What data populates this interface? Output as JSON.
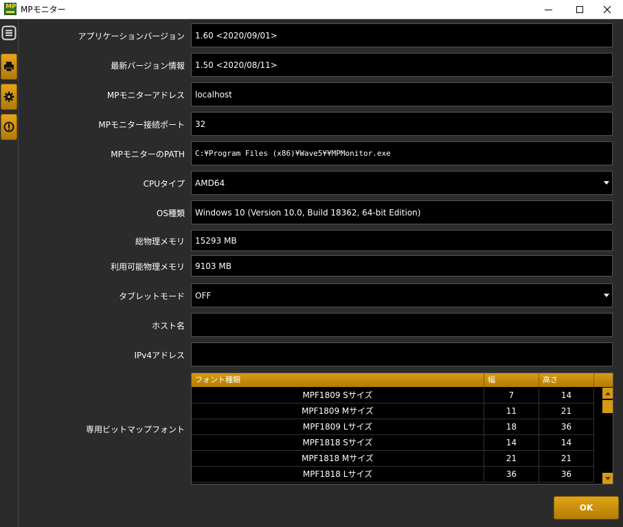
{
  "window": {
    "logo_text": "MP",
    "title": "MPモニター"
  },
  "sidebar": {
    "icons": [
      "menu-icon",
      "printer-icon",
      "gear-icon",
      "warning-icon"
    ]
  },
  "fields": {
    "app_version": {
      "label": "アプリケーションバージョン",
      "value": "1.60 <2020/09/01>"
    },
    "latest_version": {
      "label": "最新バージョン情報",
      "value": "1.50 <2020/08/11>"
    },
    "mp_address": {
      "label": "MPモニターアドレス",
      "value": "localhost"
    },
    "mp_port": {
      "label": "MPモニター接続ポート",
      "value": "32"
    },
    "mp_path": {
      "label": "MPモニターのPATH",
      "value": "C:¥Program Files (x86)¥Wave5¥¥MPMonitor.exe"
    },
    "cpu_type": {
      "label": "CPUタイプ",
      "value": "AMD64"
    },
    "os_type": {
      "label": "OS種類",
      "value": "Windows 10 (Version 10.0, Build 18362, 64-bit Edition)"
    },
    "total_memory": {
      "label": "総物理メモリ",
      "value": "15293 MB"
    },
    "avail_memory": {
      "label": "利用可能物理メモリ",
      "value": "9103 MB"
    },
    "tablet_mode": {
      "label": "タブレットモード",
      "value": "OFF"
    },
    "host_name": {
      "label": "ホスト名",
      "value": ""
    },
    "ipv4": {
      "label": "IPv4アドレス",
      "value": ""
    }
  },
  "font_table": {
    "label": "専用ビットマップフォント",
    "columns": {
      "name": "フォント種類",
      "width": "幅",
      "height": "高さ"
    },
    "rows": [
      {
        "name": "MPF1809 Sサイズ",
        "width": "7",
        "height": "14"
      },
      {
        "name": "MPF1809 Mサイズ",
        "width": "11",
        "height": "21"
      },
      {
        "name": "MPF1809 Lサイズ",
        "width": "18",
        "height": "36"
      },
      {
        "name": "MPF1818 Sサイズ",
        "width": "14",
        "height": "14"
      },
      {
        "name": "MPF1818 Mサイズ",
        "width": "21",
        "height": "21"
      },
      {
        "name": "MPF1818 Lサイズ",
        "width": "36",
        "height": "36"
      }
    ]
  },
  "buttons": {
    "ok": "OK"
  },
  "colors": {
    "accent": "#d69a12",
    "background": "#2b2b2b",
    "field_bg": "#000000"
  }
}
